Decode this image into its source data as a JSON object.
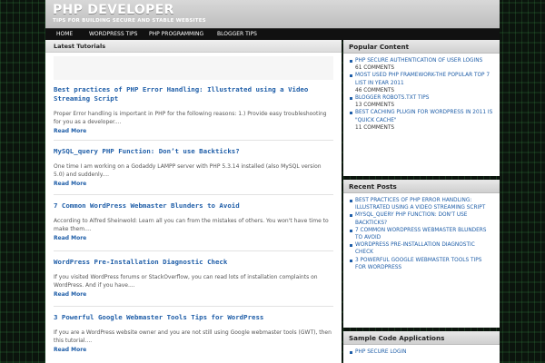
{
  "site": {
    "title": "PHP DEVELOPER",
    "tagline": "TIPS FOR BUILDING SECURE AND STABLE WEBSITES"
  },
  "nav": {
    "items": [
      {
        "label": "HOME"
      },
      {
        "label": "WORDPRESS TIPS"
      },
      {
        "label": "PHP PROGRAMMING"
      },
      {
        "label": "BLOGGER TIPS"
      }
    ]
  },
  "main": {
    "heading": "Latest Tutorials",
    "posts": [
      {
        "title": "Best practices of PHP Error Handling: Illustrated using a Video Streaming Script",
        "excerpt": "Proper Error handling is important in PHP for the following reasons: 1.) Provide easy troubleshooting for you as a developer....",
        "read_more": "Read More"
      },
      {
        "title": "MySQL_query PHP Function: Don’t use Backticks?",
        "excerpt": "One time I am working on a Godaddy LAMPP server with PHP 5.3.14 installed (also MySQL version 5.0) and suddenly....",
        "read_more": "Read More"
      },
      {
        "title": "7 Common WordPress Webmaster Blunders to Avoid",
        "excerpt": "According to Alfred Sheinwold: Learn all you can from the mistakes of others. You won't have time to make them....",
        "read_more": "Read More"
      },
      {
        "title": "WordPress Pre-Installation Diagnostic Check",
        "excerpt": "If you visited WordPress forums or StackOverflow, you can read lots of installation complaints on WordPress. And if you have....",
        "read_more": "Read More"
      },
      {
        "title": "3 Powerful Google Webmaster Tools Tips for WordPress",
        "excerpt": "If you are a WordPress website owner and you are not still using Google webmaster tools (GWT), then this tutorial....",
        "read_more": "Read More"
      }
    ]
  },
  "sidebar": {
    "popular": {
      "title": "Popular Content",
      "items": [
        {
          "label": "PHP Secure Authentication of User Logins",
          "count": "61 COMMENTS"
        },
        {
          "label": "Most Used PHP Framework-The Popular Top 7 List in Year 2011",
          "count": "46 COMMENTS"
        },
        {
          "label": "Blogger Robots.txt Tips",
          "count": "13 COMMENTS"
        },
        {
          "label": "Best Caching plugin for WordPress in 2011 is \"Quick Cache\"",
          "count": "11 COMMENTS"
        }
      ]
    },
    "recent": {
      "title": "Recent Posts",
      "items": [
        {
          "label": "Best practices of PHP Error Handling: Illustrated using a Video Streaming Script"
        },
        {
          "label": "MySQL_query PHP Function: Don't use Backticks?"
        },
        {
          "label": "7 Common WordPress Webmaster Blunders to Avoid"
        },
        {
          "label": "WordPress Pre-Installation Diagnostic Check"
        },
        {
          "label": "3 Powerful Google Webmaster Tools Tips for WordPress"
        }
      ]
    },
    "sample_code": {
      "title": "Sample Code Applications",
      "items": [
        {
          "label": "PHP Secure Login"
        }
      ]
    }
  }
}
